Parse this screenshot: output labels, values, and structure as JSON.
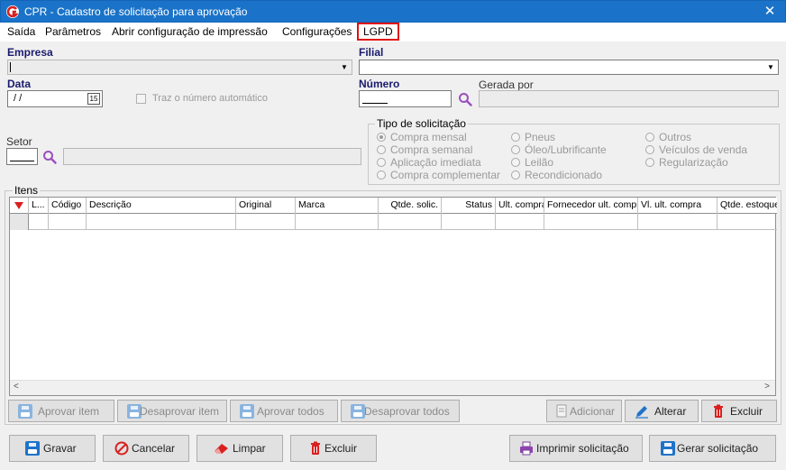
{
  "window": {
    "title": "CPR - Cadastro de solicitação para aprovação",
    "close": "✕"
  },
  "menu": [
    "Saída",
    "Parâmetros",
    "Abrir configuração de impressão",
    "Configurações",
    "LGPD"
  ],
  "form": {
    "empresa_label": "Empresa",
    "filial_label": "Filial",
    "data_label": "Data",
    "data_value": " /  /",
    "cal_glyph": "15",
    "traz_label": "Traz o número automático",
    "numero_label": "Número",
    "gerada_label": "Gerada por",
    "setor_label": "Setor"
  },
  "tipo": {
    "title": "Tipo de solicitação",
    "options": [
      "Compra mensal",
      "Compra semanal",
      "Aplicação imediata",
      "Compra complementar",
      "Pneus",
      "Óleo/Lubrificante",
      "Leilão",
      "Recondicionado",
      "Outros",
      "Veículos de venda",
      "Regularização"
    ],
    "selected": "Compra mensal"
  },
  "itens": {
    "title": "Itens",
    "columns": [
      "L...",
      "Código",
      "Descrição",
      "Original",
      "Marca",
      "Qtde. solic.",
      "Status",
      "Ult. compra",
      "Fornecedor ult. compra",
      "Vl. ult. compra",
      "Qtde. estoque"
    ]
  },
  "item_buttons": [
    "Aprovar item",
    "Desaprovar item",
    "Aprovar todos",
    "Desaprovar todos",
    "Adicionar",
    "Alterar",
    "Excluir"
  ],
  "bottom_buttons": [
    "Gravar",
    "Cancelar",
    "Limpar",
    "Excluir",
    "Imprimir solicitação",
    "Gerar solicitação"
  ],
  "colors": {
    "title_bar": "#1a73c8",
    "label_blue": "#1a1a6e",
    "highlight": "#e01010",
    "delete_red": "#d9201f",
    "search_purple": "#9b4fc0"
  }
}
